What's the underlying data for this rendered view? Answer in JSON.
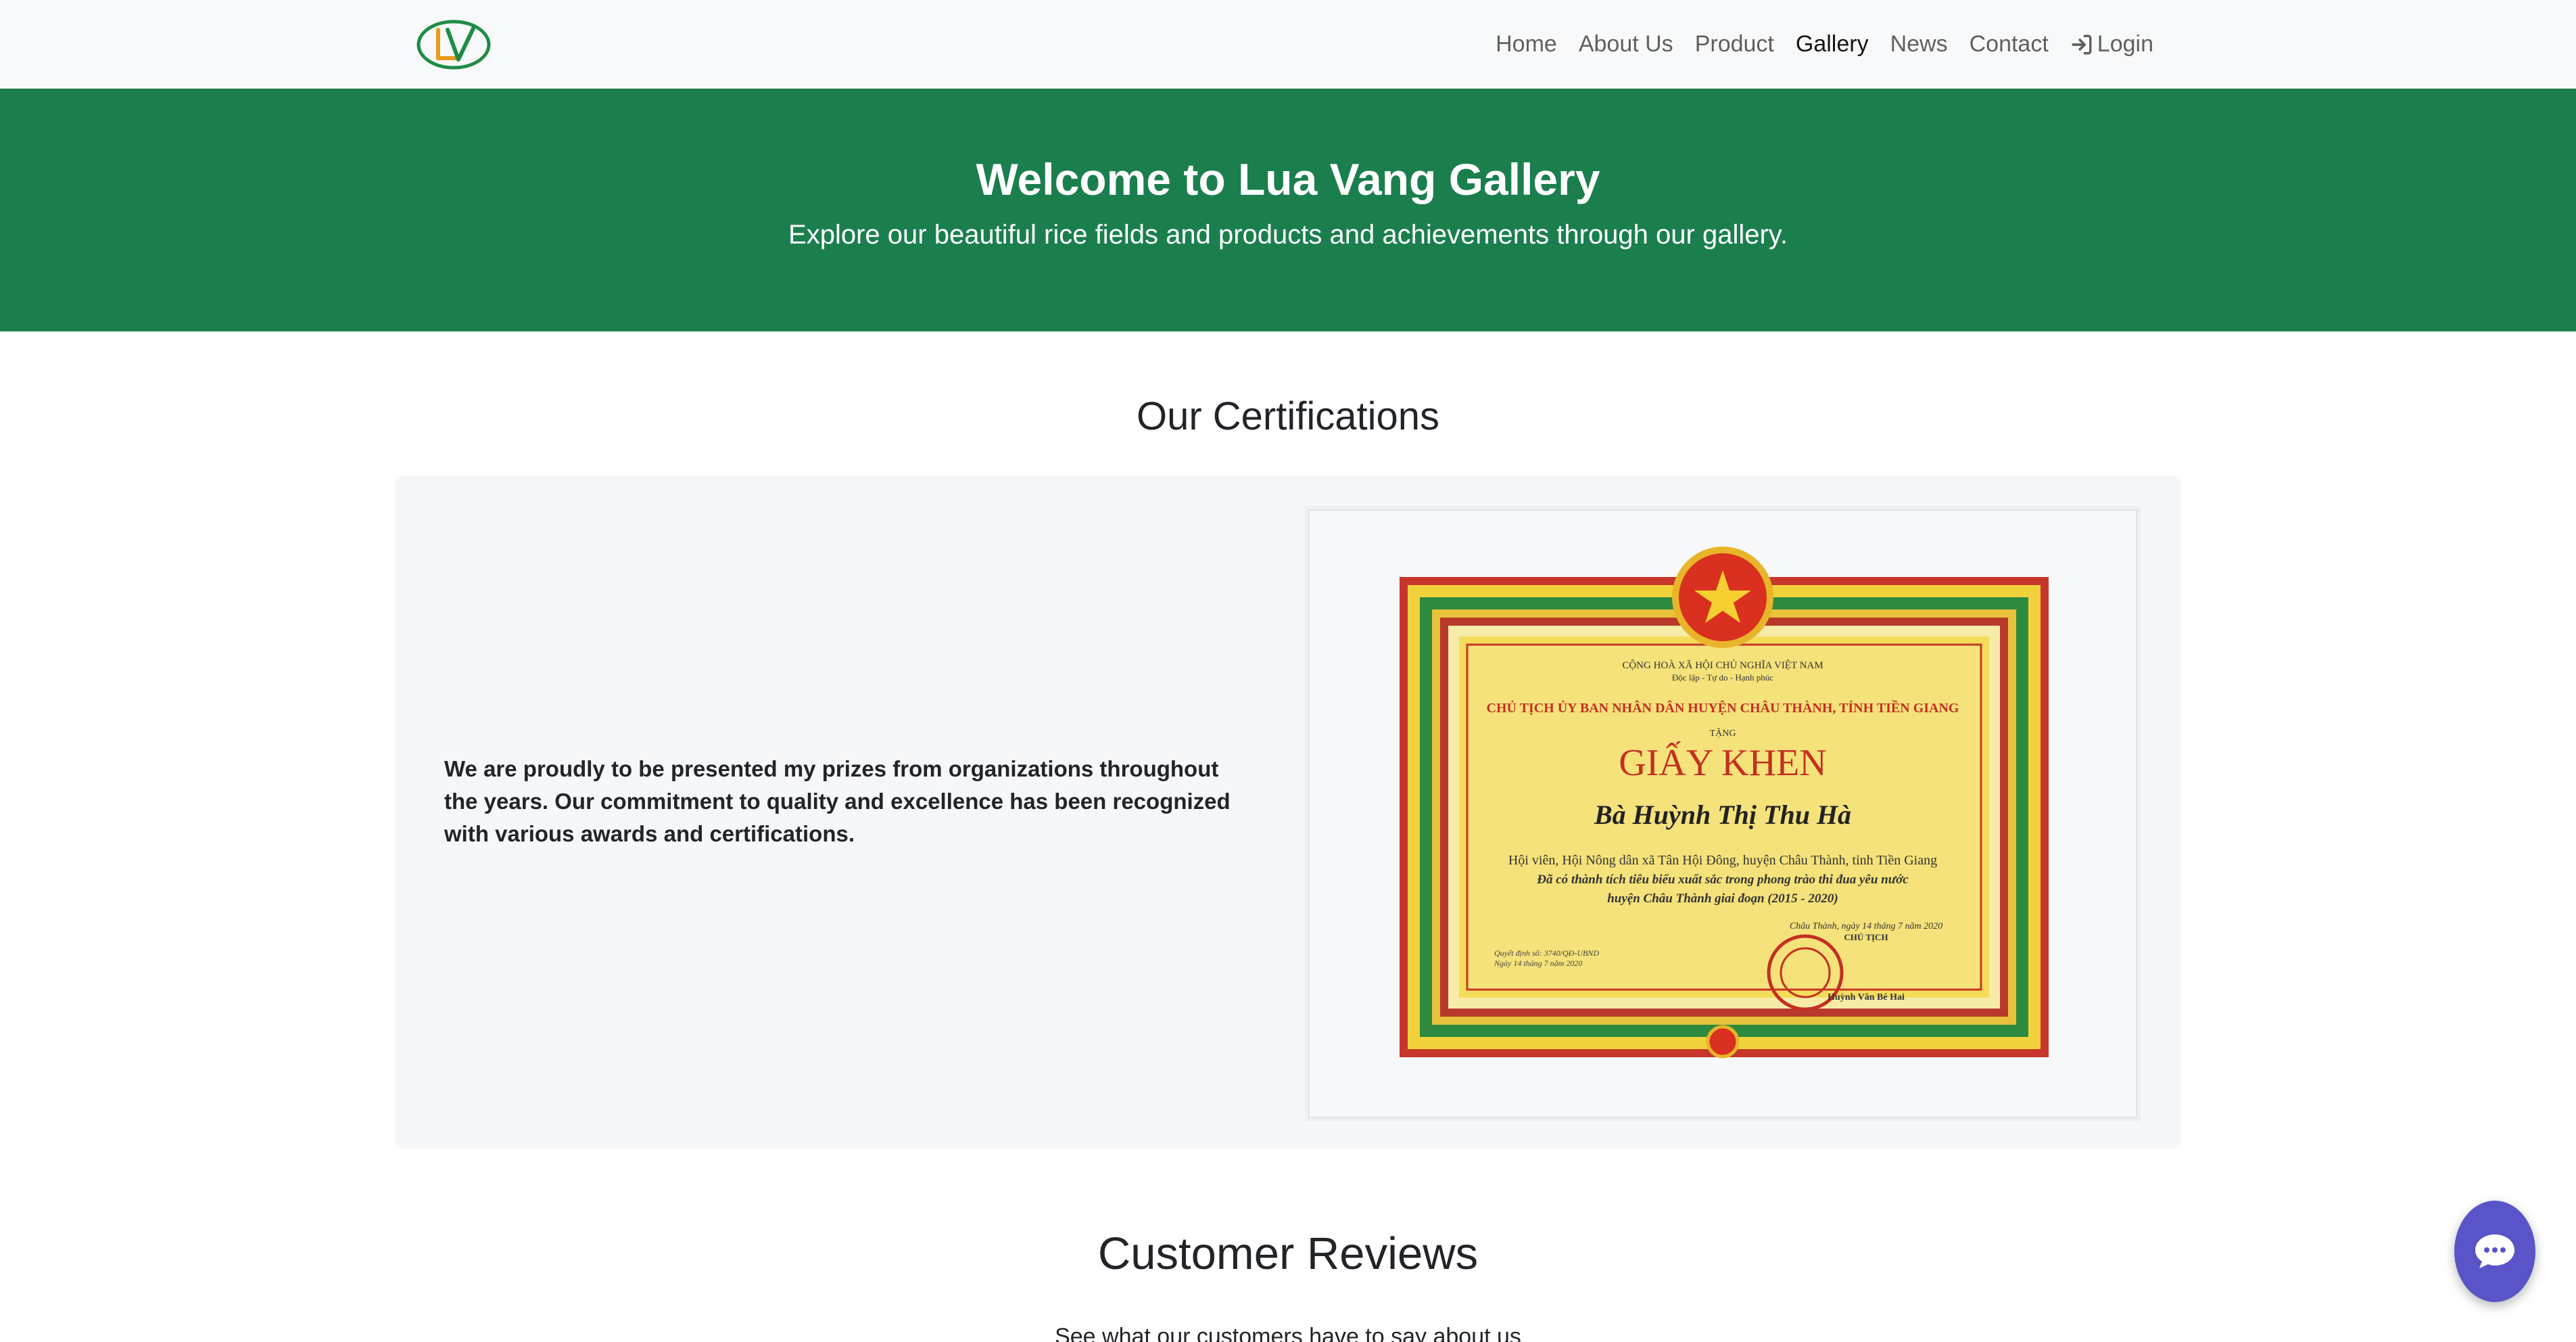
{
  "nav": {
    "items": [
      {
        "label": "Home"
      },
      {
        "label": "About Us"
      },
      {
        "label": "Product"
      },
      {
        "label": "Gallery",
        "active": true
      },
      {
        "label": "News"
      },
      {
        "label": "Contact"
      },
      {
        "label": "Login",
        "icon": "login-icon"
      }
    ]
  },
  "hero": {
    "title": "Welcome to Lua Vang Gallery",
    "subtitle": "Explore our beautiful rice fields and products and achievements through our gallery."
  },
  "certifications": {
    "title": "Our Certifications",
    "text": "We are proudly to be presented my prizes from organizations throughout the years. Our commitment to quality and excellence has been recognized with various awards and certifications.",
    "certificate": {
      "heading_small": "CỘNG HOÀ XÃ HỘI CHỦ NGHĨA VIỆT NAM",
      "motto": "Độc lập - Tự do - Hạnh phúc",
      "issuer": "CHỦ TỊCH ỦY BAN NHÂN DÂN HUYỆN CHÂU THÀNH, TỈNH TIỀN GIANG",
      "tang": "TẶNG",
      "title": "GIẤY KHEN",
      "recipient": "Bà Huỳnh Thị Thu Hà",
      "line1": "Hội viên, Hội Nông dân xã Tân Hội Đông, huyện Châu Thành, tỉnh Tiền Giang",
      "line2": "Đã có thành tích tiêu biểu xuất sắc trong phong trào thi đua yêu nước",
      "line3": "huyện Châu Thành giai đoạn (2015 - 2020)",
      "date": "Châu Thành, ngày 14 tháng 7 năm 2020",
      "role": "CHỦ TỊCH",
      "signer": "Huỳnh Văn Bé Hai",
      "decision1": "Quyết định số: 3740/QĐ-UBND",
      "decision2": "Ngày 14 tháng 7 năm 2020"
    }
  },
  "reviews": {
    "title": "Customer Reviews",
    "subtitle": "See what our customers have to say about us"
  },
  "colors": {
    "brand_green": "#1b7f4d",
    "navbar_bg": "#f8f9fa",
    "card_bg": "#f6f7f9",
    "chat_purple": "#5a54c9"
  },
  "icons": [
    "logo-icon",
    "login-icon",
    "chat-icon"
  ]
}
